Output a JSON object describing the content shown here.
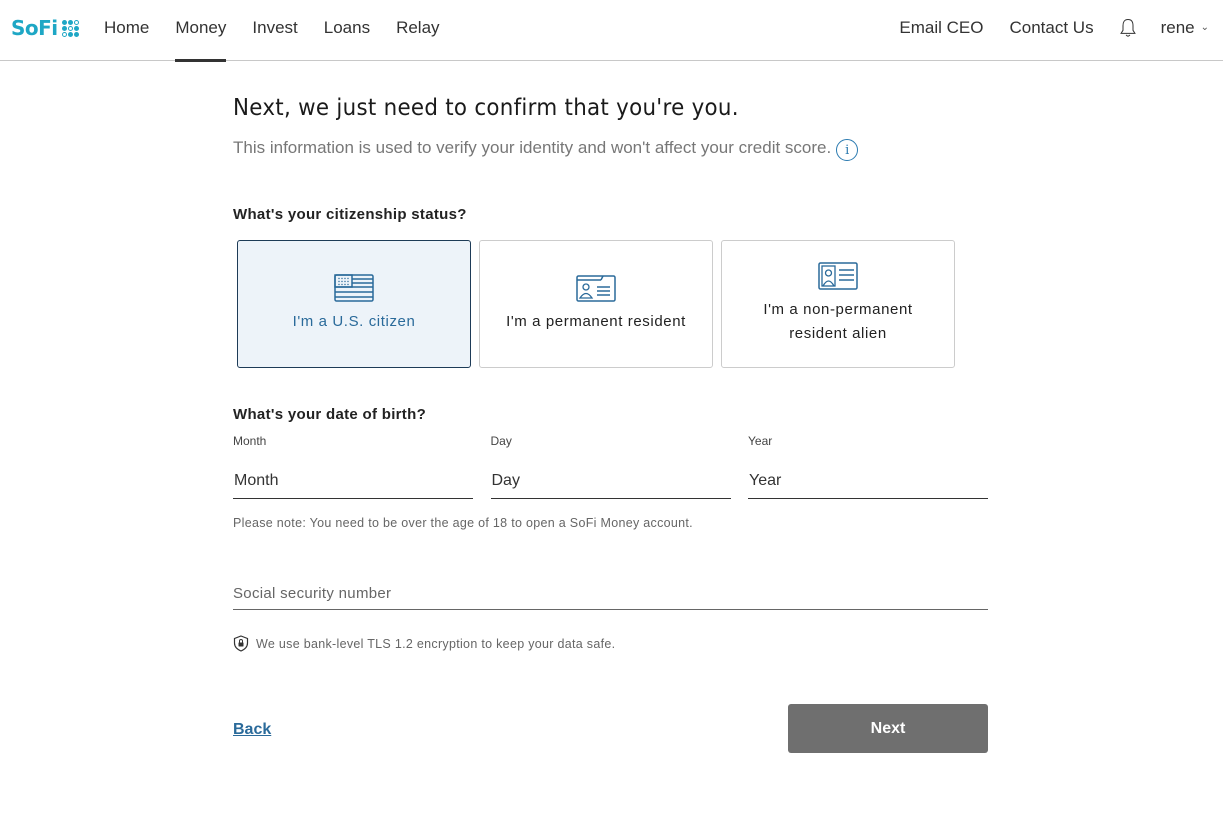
{
  "header": {
    "logo_text": "SoFi",
    "nav": [
      {
        "label": "Home",
        "active": false
      },
      {
        "label": "Money",
        "active": true
      },
      {
        "label": "Invest",
        "active": false
      },
      {
        "label": "Loans",
        "active": false
      },
      {
        "label": "Relay",
        "active": false
      }
    ],
    "email_ceo": "Email CEO",
    "contact_us": "Contact Us",
    "user_name": "rene",
    "user_chevron": "⌄",
    "icons": {
      "notifications": "bell-icon",
      "user_menu": "chevron-down-icon"
    }
  },
  "main": {
    "title": "Next, we just need to confirm that you're you.",
    "subtitle": "This information is used to verify your identity and won't affect your credit score.",
    "info_glyph": "i",
    "citizenship": {
      "question": "What's your citizenship status?",
      "selected": 0,
      "options": [
        {
          "label": "I'm a U.S. citizen",
          "icon": "us-flag-icon"
        },
        {
          "label": "I'm a permanent resident",
          "icon": "green-card-icon"
        },
        {
          "label": "I'm a non-permanent resident alien",
          "icon": "id-card-icon"
        }
      ]
    },
    "dob": {
      "question": "What's your date of birth?",
      "month": {
        "label": "Month",
        "placeholder": "Month",
        "value": ""
      },
      "day": {
        "label": "Day",
        "placeholder": "Day",
        "value": ""
      },
      "year": {
        "label": "Year",
        "placeholder": "Year",
        "value": ""
      },
      "note": "Please note: You need to be over the age of 18 to open a SoFi Money account."
    },
    "ssn": {
      "placeholder": "Social security number",
      "value": ""
    },
    "security_note": "We use bank-level TLS 1.2 encryption to keep your data safe.",
    "back_label": "Back",
    "next_label": "Next"
  },
  "colors": {
    "brand": "#1ea7c5",
    "accent": "#2a6a9a",
    "selected_bg": "#edf3f9",
    "selected_border": "#1d3b57",
    "next_button": "#6f6f6f"
  }
}
